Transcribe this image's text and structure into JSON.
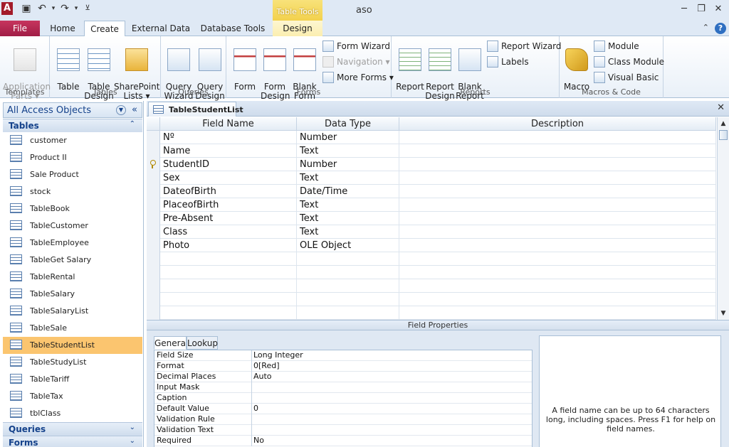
{
  "window": {
    "app_logo": "A",
    "title": "aso",
    "tool_tab_header": "Table Tools"
  },
  "quick_access": {
    "icons": [
      "save-icon",
      "undo-icon",
      "redo-icon",
      "customize-icon"
    ]
  },
  "tabs": {
    "file": "File",
    "home": "Home",
    "create": "Create",
    "external_data": "External Data",
    "database_tools": "Database Tools",
    "design": "Design"
  },
  "ribbon": {
    "templates": {
      "label": "Templates",
      "application_parts": "Application\nParts ▾"
    },
    "tables": {
      "label": "Tables",
      "table": "Table",
      "table_design": "Table\nDesign",
      "sharepoint_lists": "SharePoint\nLists ▾"
    },
    "queries": {
      "label": "Queries",
      "query_wizard": "Query\nWizard",
      "query_design": "Query\nDesign"
    },
    "forms": {
      "label": "Forms",
      "form": "Form",
      "form_design": "Form\nDesign",
      "blank_form": "Blank\nForm",
      "form_wizard": "Form Wizard",
      "navigation": "Navigation ▾",
      "more_forms": "More Forms ▾"
    },
    "reports": {
      "label": "Reports",
      "report": "Report",
      "report_design": "Report\nDesign",
      "blank_report": "Blank\nReport",
      "report_wizard": "Report Wizard",
      "labels": "Labels"
    },
    "macros": {
      "label": "Macros & Code",
      "macro": "Macro",
      "module": "Module",
      "class_module": "Class Module",
      "visual_basic": "Visual Basic"
    }
  },
  "nav": {
    "title": "All Access Objects",
    "tables_section": "Tables",
    "tables": [
      "customer",
      "Product II",
      "Sale Product",
      "stock",
      "TableBook",
      "TableCustomer",
      "TableEmployee",
      "TableGet Salary",
      "TableRental",
      "TableSalary",
      "TableSalaryList",
      "TableSale",
      "TableStudentList",
      "TableStudyList",
      "TableTariff",
      "TableTax",
      "tblClass"
    ],
    "selected": "TableStudentList",
    "queries_section": "Queries",
    "forms_section": "Forms"
  },
  "document": {
    "tab_label": "TableStudentList",
    "headers": {
      "field_name": "Field Name",
      "data_type": "Data Type",
      "description": "Description"
    },
    "rows": [
      {
        "field": "Nº",
        "type": "Number"
      },
      {
        "field": "Name",
        "type": "Text"
      },
      {
        "field": "StudentID",
        "type": "Number"
      },
      {
        "field": "Sex",
        "type": "Text"
      },
      {
        "field": "DateofBirth",
        "type": "Date/Time"
      },
      {
        "field": "PlaceofBirth",
        "type": "Text"
      },
      {
        "field": "Pre-Absent",
        "type": "Text"
      },
      {
        "field": "Class",
        "type": "Text"
      },
      {
        "field": "Photo",
        "type": "OLE Object"
      }
    ],
    "primary_key_row": 2
  },
  "field_properties": {
    "title": "Field Properties",
    "tab_general": "General",
    "tab_lookup": "Lookup",
    "props": [
      {
        "k": "Field Size",
        "v": "Long Integer"
      },
      {
        "k": "Format",
        "v": "0[Red]"
      },
      {
        "k": "Decimal Places",
        "v": "Auto"
      },
      {
        "k": "Input Mask",
        "v": ""
      },
      {
        "k": "Caption",
        "v": ""
      },
      {
        "k": "Default Value",
        "v": "0"
      },
      {
        "k": "Validation Rule",
        "v": ""
      },
      {
        "k": "Validation Text",
        "v": ""
      },
      {
        "k": "Required",
        "v": "No"
      }
    ],
    "help": "A field name can be up to 64 characters long, including spaces. Press F1 for help on field names."
  }
}
